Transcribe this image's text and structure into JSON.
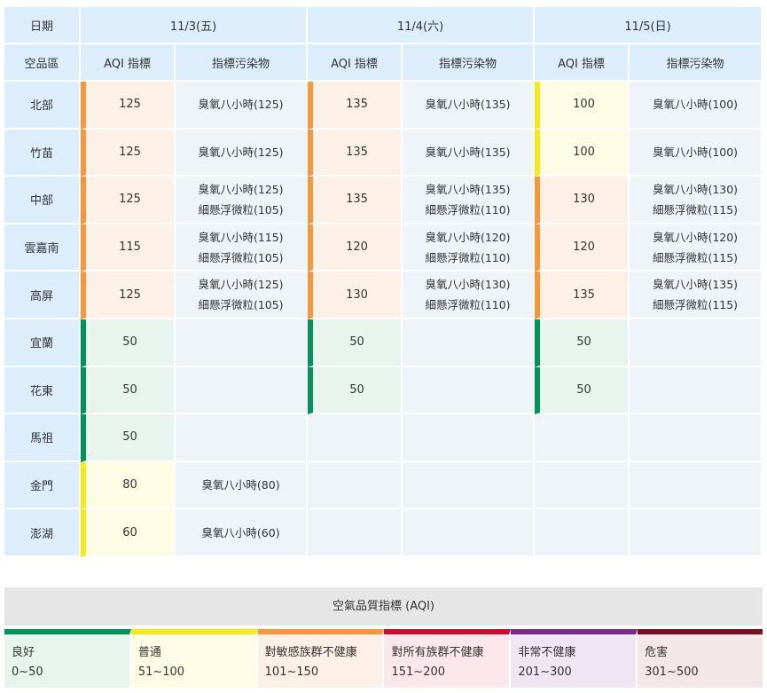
{
  "table": {
    "header_date": "日期",
    "header_region": "空品區",
    "days": [
      {
        "label": "11/3(五)",
        "aqi_header": "AQI 指標",
        "pollutant_header": "指標污染物"
      },
      {
        "label": "11/4(六)",
        "aqi_header": "AQI 指標",
        "pollutant_header": "指標污染物"
      },
      {
        "label": "11/5(日)",
        "aqi_header": "AQI 指標",
        "pollutant_header": "指標污染物"
      }
    ],
    "rows": [
      {
        "region": "北部",
        "cells": [
          {
            "aqi": "125",
            "level": "sensitive",
            "pollutants": [
              "臭氧八小時(125)"
            ]
          },
          {
            "aqi": "135",
            "level": "sensitive",
            "pollutants": [
              "臭氧八小時(135)"
            ]
          },
          {
            "aqi": "100",
            "level": "moderate",
            "pollutants": [
              "臭氧八小時(100)"
            ]
          }
        ]
      },
      {
        "region": "竹苗",
        "cells": [
          {
            "aqi": "125",
            "level": "sensitive",
            "pollutants": [
              "臭氧八小時(125)"
            ]
          },
          {
            "aqi": "135",
            "level": "sensitive",
            "pollutants": [
              "臭氧八小時(135)"
            ]
          },
          {
            "aqi": "100",
            "level": "moderate",
            "pollutants": [
              "臭氧八小時(100)"
            ]
          }
        ]
      },
      {
        "region": "中部",
        "cells": [
          {
            "aqi": "125",
            "level": "sensitive",
            "pollutants": [
              "臭氧八小時(125)",
              "細懸浮微粒(105)"
            ]
          },
          {
            "aqi": "135",
            "level": "sensitive",
            "pollutants": [
              "臭氧八小時(135)",
              "細懸浮微粒(110)"
            ]
          },
          {
            "aqi": "130",
            "level": "sensitive",
            "pollutants": [
              "臭氧八小時(130)",
              "細懸浮微粒(115)"
            ]
          }
        ]
      },
      {
        "region": "雲嘉南",
        "cells": [
          {
            "aqi": "115",
            "level": "sensitive",
            "pollutants": [
              "臭氧八小時(115)",
              "細懸浮微粒(105)"
            ]
          },
          {
            "aqi": "120",
            "level": "sensitive",
            "pollutants": [
              "臭氧八小時(120)",
              "細懸浮微粒(110)"
            ]
          },
          {
            "aqi": "120",
            "level": "sensitive",
            "pollutants": [
              "臭氧八小時(120)",
              "細懸浮微粒(115)"
            ]
          }
        ]
      },
      {
        "region": "高屏",
        "cells": [
          {
            "aqi": "125",
            "level": "sensitive",
            "pollutants": [
              "臭氧八小時(125)",
              "細懸浮微粒(105)"
            ]
          },
          {
            "aqi": "130",
            "level": "sensitive",
            "pollutants": [
              "臭氧八小時(130)",
              "細懸浮微粒(110)"
            ]
          },
          {
            "aqi": "135",
            "level": "sensitive",
            "pollutants": [
              "臭氧八小時(135)",
              "細懸浮微粒(115)"
            ]
          }
        ]
      },
      {
        "region": "宜蘭",
        "cells": [
          {
            "aqi": "50",
            "level": "good",
            "pollutants": []
          },
          {
            "aqi": "50",
            "level": "good",
            "pollutants": []
          },
          {
            "aqi": "50",
            "level": "good",
            "pollutants": []
          }
        ]
      },
      {
        "region": "花東",
        "cells": [
          {
            "aqi": "50",
            "level": "good",
            "pollutants": []
          },
          {
            "aqi": "50",
            "level": "good",
            "pollutants": []
          },
          {
            "aqi": "50",
            "level": "good",
            "pollutants": []
          }
        ]
      },
      {
        "region": "馬祖",
        "cells": [
          {
            "aqi": "50",
            "level": "good",
            "pollutants": []
          },
          null,
          null
        ]
      },
      {
        "region": "金門",
        "cells": [
          {
            "aqi": "80",
            "level": "moderate",
            "pollutants": [
              "臭氧八小時(80)"
            ]
          },
          null,
          null
        ]
      },
      {
        "region": "澎湖",
        "cells": [
          {
            "aqi": "60",
            "level": "moderate",
            "pollutants": [
              "臭氧八小時(60)"
            ]
          },
          null,
          null
        ]
      }
    ]
  },
  "legend": {
    "title": "空氣品質指標 (AQI)",
    "levels": [
      {
        "key": "good",
        "name": "良好",
        "range": "0~50",
        "color": "#00945a"
      },
      {
        "key": "moderate",
        "name": "普通",
        "range": "51~100",
        "color": "#f5ea1c"
      },
      {
        "key": "sensitive",
        "name": "對敏感族群不健康",
        "range": "101~150",
        "color": "#f7963b"
      },
      {
        "key": "unhealthy",
        "name": "對所有族群不健康",
        "range": "151~200",
        "color": "#c8102e"
      },
      {
        "key": "very",
        "name": "非常不健康",
        "range": "201~300",
        "color": "#7b2a8c"
      },
      {
        "key": "hazard",
        "name": "危害",
        "range": "301~500",
        "color": "#7a0f24"
      }
    ]
  }
}
